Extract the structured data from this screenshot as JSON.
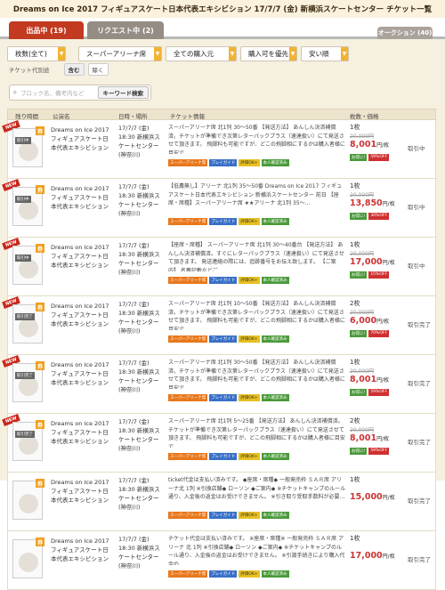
{
  "title": "Dreams on Ice 2017 フィギュアスケート日本代表エキシビション 17/7/7 (金) 新横浜スケートセンター チケット一覧",
  "tabs": {
    "active": "出品中 (19)",
    "request": "リクエスト中 (2)",
    "auction": "オークション (40)"
  },
  "filters": {
    "count": "枚数(全て)",
    "seat": "スーパーアリーナ席",
    "all": "全ての購入元",
    "sort1": "購入可を優先",
    "sort2": "安い順"
  },
  "code_filter": {
    "label": "チケット代別途",
    "include": "含む",
    "exclude": "除く"
  },
  "search": {
    "placeholder": "ブロック名、備考内など",
    "button": "キーワード検索"
  },
  "table_headers": {
    "remain": "残り時間",
    "name": "公演名",
    "date": "日時・場所",
    "info": "チケット情報",
    "price": "枚数・価格"
  },
  "rows": [
    {
      "new": "NEW",
      "thumb_label": "取引中",
      "name": "Dreams on Ice 2017 フィギュアスケート日本代表エキシビション",
      "date": "17/7/7 (金) 18:30 新横浜スケートセンター (神奈川)",
      "info": "スーパーアリーナ席 北1列 30〜50番 【発送方法】 あんしん決済補償済。チケットが準備でき次第レターパックプラス（速達扱い）にて発送させて頂きます。 飛脚料も可能ですが、どこの飛脚相にするかは購入者様に目安で...",
      "qty": "1枚",
      "orig": "20,000円",
      "price": "8,001",
      "unit": "円/枚",
      "discount": "59%OFF",
      "status": "取引中"
    },
    {
      "new": "NEW",
      "thumb_label": "取引中",
      "name": "Dreams on Ice 2017 フィギュアスケート日本代表エキシビション",
      "date": "17/7/7 (金) 18:30 新横浜スケートセンター (神奈川)",
      "info": "【低農無し】アリーナ 北1列 35〜50番 Dreams on Ice 2017 フィギュアスケート日本代表エキシビション 新横浜スケートセンター 前日 【座席・席種】スーパーアリーナ席 ★★アリーナ 北1列 35〜...",
      "qty": "1枚",
      "orig": "20,000円",
      "price": "13,850",
      "unit": "円/枚",
      "discount": "30%OFF",
      "status": "取引中"
    },
    {
      "new": "NEW",
      "thumb_label": "取引中",
      "name": "Dreams on Ice 2017 フィギュアスケート日本代表エキシビション",
      "date": "17/7/7 (金) 18:30 新横浜スケートセンター (神奈川)",
      "info": "【座席・席種】 スーパーアリーナ席 北1列 30〜40番台 【発送方法】 あんしん決済補償済。すぐにレターパックプラス（速達扱い）にて発送させて頂きます。 発送連絡の際には、追跡番号をお伝え致します。 【ご案内】 名義記載などご...",
      "qty": "1枚",
      "orig": "20,000円",
      "price": "17,000",
      "unit": "円/枚",
      "discount": "15%OFF",
      "status": "取引中"
    },
    {
      "new": "NEW",
      "thumb_label": "取引完了",
      "name": "Dreams on Ice 2017 フィギュアスケート日本代表エキシビション",
      "date": "17/7/7 (金) 18:30 新横浜スケートセンター (神奈川)",
      "info": "スーパーアリーナ席 北1列 10〜50番 【発送方法】 あんしん決済補償済。チケットが準備でき次第レターパックプラス（速達扱い）にて発送させて頂きます。 飛脚料も可能ですが、どこの飛脚相にするかは購入者様に目安で...",
      "qty": "2枚",
      "orig": "20,000円",
      "price": "6,000",
      "unit": "円/枚",
      "discount": "70%OFF",
      "status": "取引完了"
    },
    {
      "new": "NEW",
      "thumb_label": "取引完了",
      "name": "Dreams on Ice 2017 フィギュアスケート日本代表エキシビション",
      "date": "17/7/7 (金) 18:30 新横浜スケートセンター (神奈川)",
      "info": "スーパーアリーナ席 北1列 30〜50番 【発送方法】 あんしん決済補償済。チケットが準備でき次第レターパックプラス（速達扱い）にて発送させて頂きます。 飛脚料も可能ですが、どこの飛脚相にするかは購入者様に目安で...",
      "qty": "1枚",
      "orig": "20,000円",
      "price": "8,001",
      "unit": "円/枚",
      "discount": "59%OFF",
      "status": "取引完了"
    },
    {
      "new": "NEW",
      "thumb_label": "取引完了",
      "name": "Dreams on Ice 2017 フィギュアスケート日本代表エキシビション",
      "date": "17/7/7 (金) 18:30 新横浜スケートセンター (神奈川)",
      "info": "スーパーアリーナ席 北1列 5〜25番 【発送方法】 あんしん決済補償済。チケットが準備でき次第レターパックプラス（速達扱い）にて発送させて頂きます。 飛脚料も可能ですが、どこの飛脚相にするかは購入者様に目安で...",
      "qty": "2枚",
      "orig": "20,000円",
      "price": "8,001",
      "unit": "円/枚",
      "discount": "59%OFF",
      "status": "取引完了"
    },
    {
      "new": "",
      "thumb_label": "",
      "name": "Dreams on Ice 2017 フィギュアスケート日本代表エキシビション",
      "date": "17/7/7 (金) 18:30 新横浜スケートセンター (神奈川)",
      "info": "ticket代金は支払い済みです。 ◆座席・席種◆ 一般発売枠 ＳＡＲ席 アリーナ北 1列 ※引換店舗◆ ローソン ◆ご案内◆ ※チケットキャンプのルール通り、入金後の返金はお受けできません。 ※引き取り受取手数料が必要...",
      "qty": "1枚",
      "orig": "",
      "price": "15,000",
      "unit": "円/枚",
      "discount": "",
      "status": "取引完了"
    },
    {
      "new": "",
      "thumb_label": "",
      "name": "Dreams on Ice 2017 フィギュアスケート日本代表エキシビション",
      "date": "17/7/7 (金) 18:30 新横浜スケートセンター (神奈川)",
      "info": "チケット代金は支払い済みです。 ※座席・席種※ 一般発売枠 ＳＡＲ席 アリーナ 北 1列 ※引換店舗◆ ローソン ◆ご案内◆ ※チケットキャンプのルール通り、入金後の返金はお受けできません。 ※引渡手続きにより購入代金の...",
      "qty": "1枚",
      "orig": "",
      "price": "17,000",
      "unit": "円/枚",
      "discount": "",
      "status": "取引完了"
    }
  ],
  "tags": [
    "スーパーアリーナ席",
    "プレイガイド",
    "評価OK+",
    "本人確認済み"
  ],
  "safe_label": "お得に!"
}
